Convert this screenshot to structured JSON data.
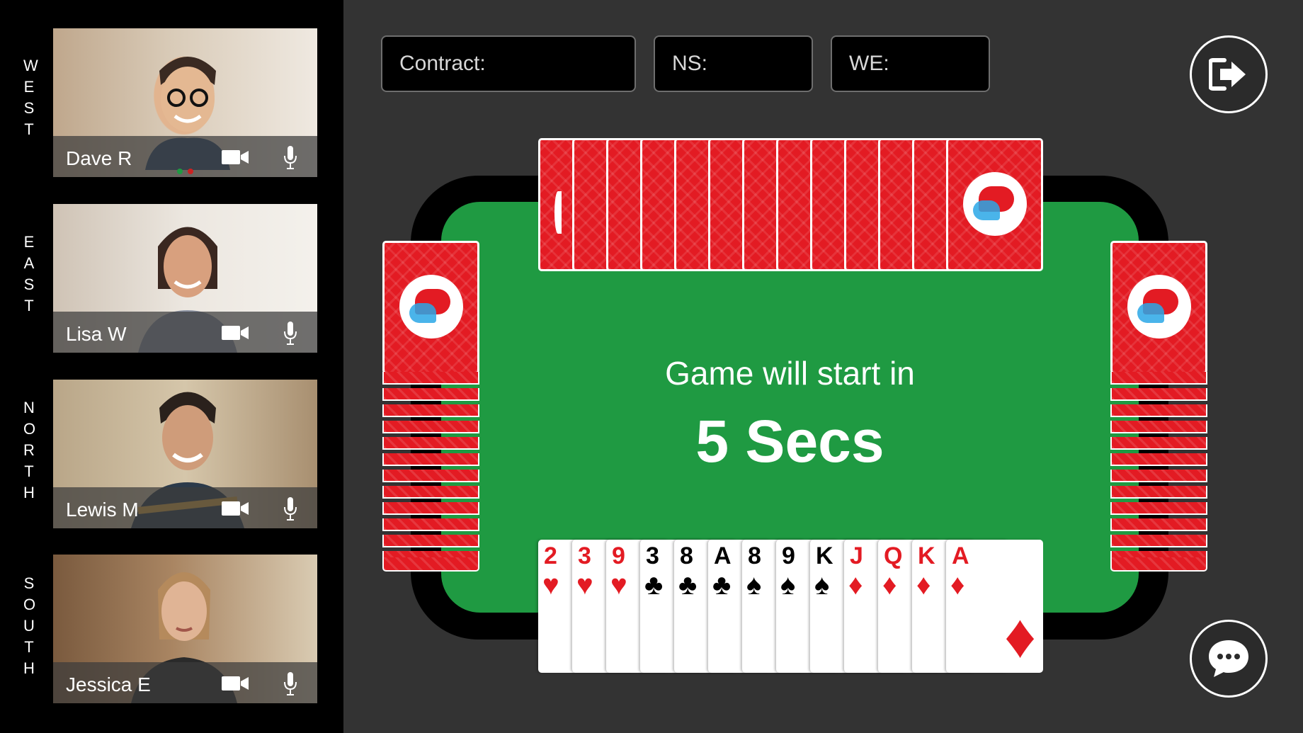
{
  "seats": [
    {
      "label": "WEST",
      "player": "Dave R"
    },
    {
      "label": "EAST",
      "player": "Lisa W"
    },
    {
      "label": "NORTH",
      "player": "Lewis M"
    },
    {
      "label": "SOUTH",
      "player": "Jessica E"
    }
  ],
  "scoreboard": {
    "contract_label": "Contract:",
    "ns_label": "NS:",
    "we_label": "WE:"
  },
  "countdown": {
    "line1": "Game will start in",
    "line2": "5 Secs"
  },
  "hand": [
    {
      "rank": "2",
      "suit": "♥",
      "color": "red"
    },
    {
      "rank": "3",
      "suit": "♥",
      "color": "red"
    },
    {
      "rank": "9",
      "suit": "♥",
      "color": "red"
    },
    {
      "rank": "3",
      "suit": "♣",
      "color": "black"
    },
    {
      "rank": "8",
      "suit": "♣",
      "color": "black"
    },
    {
      "rank": "A",
      "suit": "♣",
      "color": "black"
    },
    {
      "rank": "8",
      "suit": "♠",
      "color": "black"
    },
    {
      "rank": "9",
      "suit": "♠",
      "color": "black"
    },
    {
      "rank": "K",
      "suit": "♠",
      "color": "black"
    },
    {
      "rank": "J",
      "suit": "♦",
      "color": "red"
    },
    {
      "rank": "Q",
      "suit": "♦",
      "color": "red"
    },
    {
      "rank": "K",
      "suit": "♦",
      "color": "red"
    },
    {
      "rank": "A",
      "suit": "♦",
      "color": "red"
    }
  ],
  "opponent_card_counts": {
    "north": 13,
    "west": 13,
    "east": 13
  },
  "icons": {
    "exit": "exit-icon",
    "chat": "chat-icon",
    "camera": "video-camera-icon",
    "microphone": "microphone-icon"
  },
  "colors": {
    "felt": "#1f9a42",
    "card_back": "#e31b23",
    "background": "#333333"
  }
}
